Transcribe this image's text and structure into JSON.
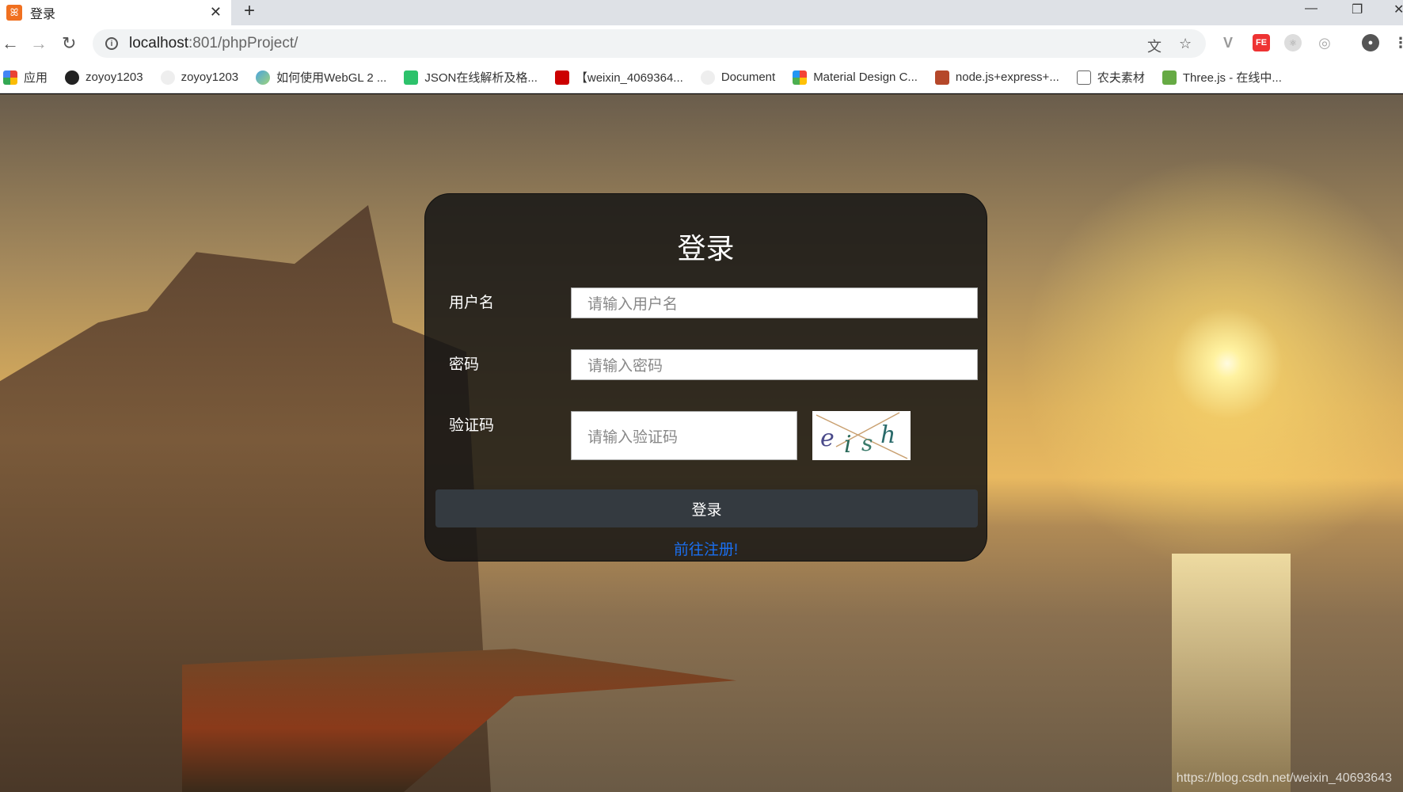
{
  "browser": {
    "tab_title": "登录",
    "new_tab": "+",
    "url_host": "localhost",
    "url_rest": ":801/phpProject/",
    "bookmarks": [
      {
        "label": "应用",
        "icon": "apps-grid-icon"
      },
      {
        "label": "zoyoy1203",
        "icon": "github-icon"
      },
      {
        "label": "zoyoy1203",
        "icon": "panda-icon"
      },
      {
        "label": "如何使用WebGL 2 ...",
        "icon": "globe-icon"
      },
      {
        "label": "JSON在线解析及格...",
        "icon": "json-icon"
      },
      {
        "label": "【weixin_4069364...",
        "icon": "csdn-icon"
      },
      {
        "label": "Document",
        "icon": "panda-icon"
      },
      {
        "label": "Material Design C...",
        "icon": "material-icon"
      },
      {
        "label": "node.js+express+...",
        "icon": "js-icon"
      },
      {
        "label": "农夫素材",
        "icon": "page-icon"
      },
      {
        "label": "Three.js - 在线中...",
        "icon": "tree-icon"
      }
    ]
  },
  "login": {
    "title": "登录",
    "username_label": "用户名",
    "username_placeholder": "请输入用户名",
    "password_label": "密码",
    "password_placeholder": "请输入密码",
    "captcha_label": "验证码",
    "captcha_placeholder": "请输入验证码",
    "captcha_text": "eish",
    "submit": "登录",
    "register_link": "前往注册!"
  },
  "watermark": "https://blog.csdn.net/weixin_40693643",
  "colors": {
    "link": "#1a6ff0",
    "button": "#343a40"
  }
}
